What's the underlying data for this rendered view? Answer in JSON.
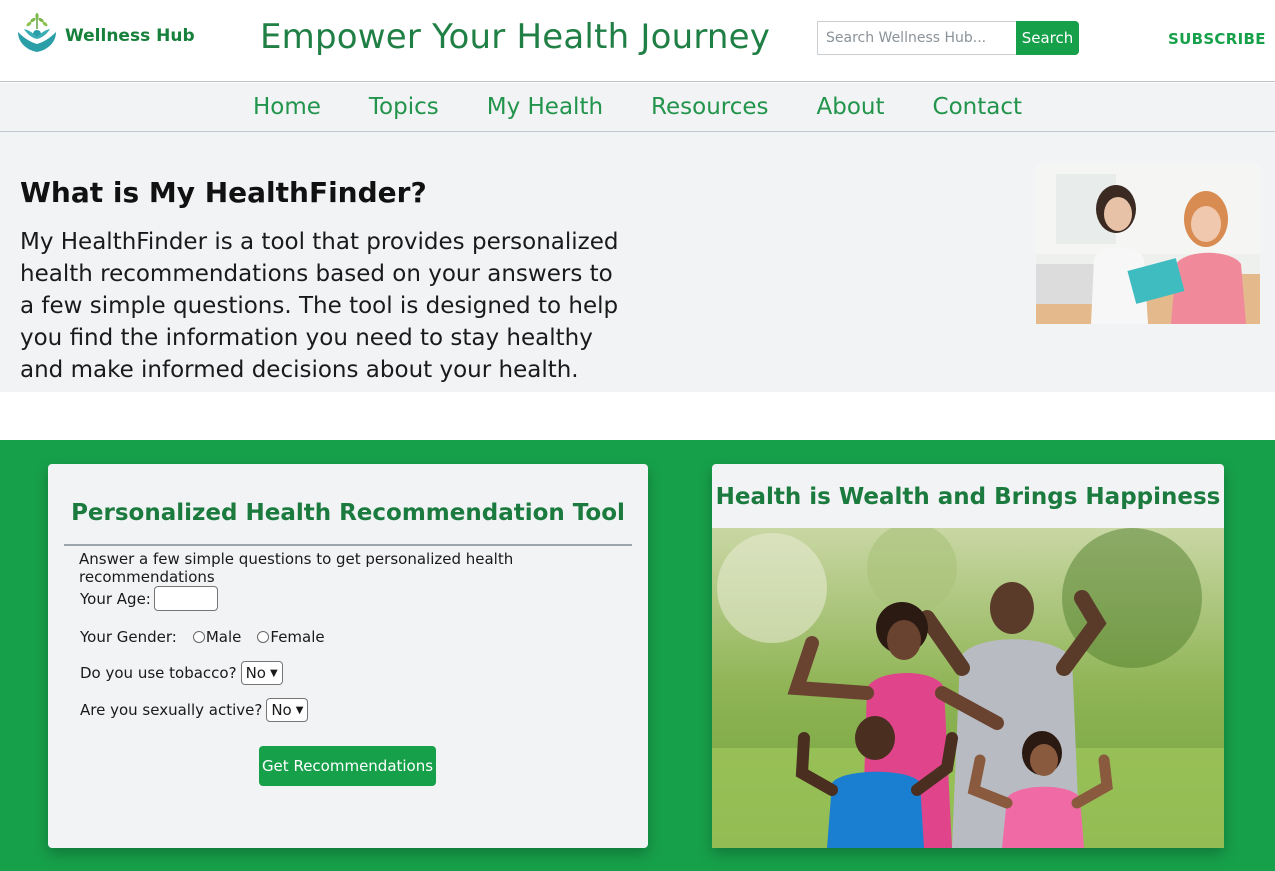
{
  "header": {
    "logo_text": "Wellness Hub",
    "title": "Empower Your Health Journey",
    "search_placeholder": "Search Wellness Hub...",
    "search_label": "Search",
    "subscribe_label": "SUBSCRIBE"
  },
  "nav": {
    "items": [
      "Home",
      "Topics",
      "My Health",
      "Resources",
      "About",
      "Contact"
    ]
  },
  "about": {
    "heading": "What is My HealthFinder?",
    "body": "My HealthFinder is a tool that provides personalized health recommendations based on your answers to a few simple questions. The tool is designed to help you find the information you need to stay healthy and make informed decisions about your health."
  },
  "tool": {
    "title": "Personalized Health Recommendation Tool",
    "subtitle": "Answer a few simple questions to get personalized health recommendations",
    "age_label": "Your Age:",
    "gender_label": "Your Gender:",
    "gender_options": [
      "Male",
      "Female"
    ],
    "tobacco_label": "Do you use tobacco?",
    "tobacco_value": "No",
    "sexual_label": "Are you sexually active?",
    "sexual_value": "No",
    "submit_label": "Get Recommendations"
  },
  "photo_card": {
    "title": "Health is Wealth and Brings Happiness"
  },
  "colors": {
    "brand_green": "#17a04a",
    "dark_green": "#1b7a3d",
    "panel_gray": "#f1f3f5"
  }
}
